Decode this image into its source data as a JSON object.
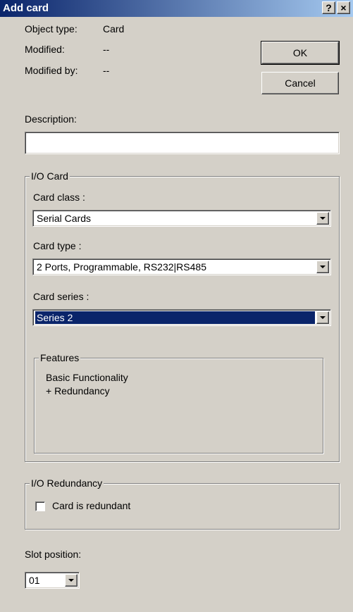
{
  "window": {
    "title": "Add card",
    "help_label": "?",
    "close_label": "×"
  },
  "info": {
    "object_type_label": "Object type:",
    "object_type_value": "Card",
    "modified_label": "Modified:",
    "modified_value": "--",
    "modified_by_label": "Modified by:",
    "modified_by_value": "--"
  },
  "buttons": {
    "ok_label": "OK",
    "cancel_label": "Cancel"
  },
  "description": {
    "label": "Description:",
    "value": ""
  },
  "io_card": {
    "group_title": "I/O Card",
    "card_class_label": "Card class :",
    "card_class_value": "Serial Cards",
    "card_type_label": "Card type :",
    "card_type_value": "2 Ports, Programmable, RS232|RS485",
    "card_series_label": "Card series :",
    "card_series_value": "Series 2",
    "features": {
      "group_title": "Features",
      "lines": [
        "Basic Functionality",
        "+ Redundancy"
      ]
    }
  },
  "io_redundancy": {
    "group_title": "I/O Redundancy",
    "checkbox_label": "Card is redundant",
    "checked": false
  },
  "slot": {
    "label": "Slot position:",
    "value": "01"
  },
  "colors": {
    "title_gradient_start": "#0a246a",
    "title_gradient_end": "#a6caf0",
    "selection": "#0a246a",
    "dialog_bg": "#d4d0c8"
  }
}
